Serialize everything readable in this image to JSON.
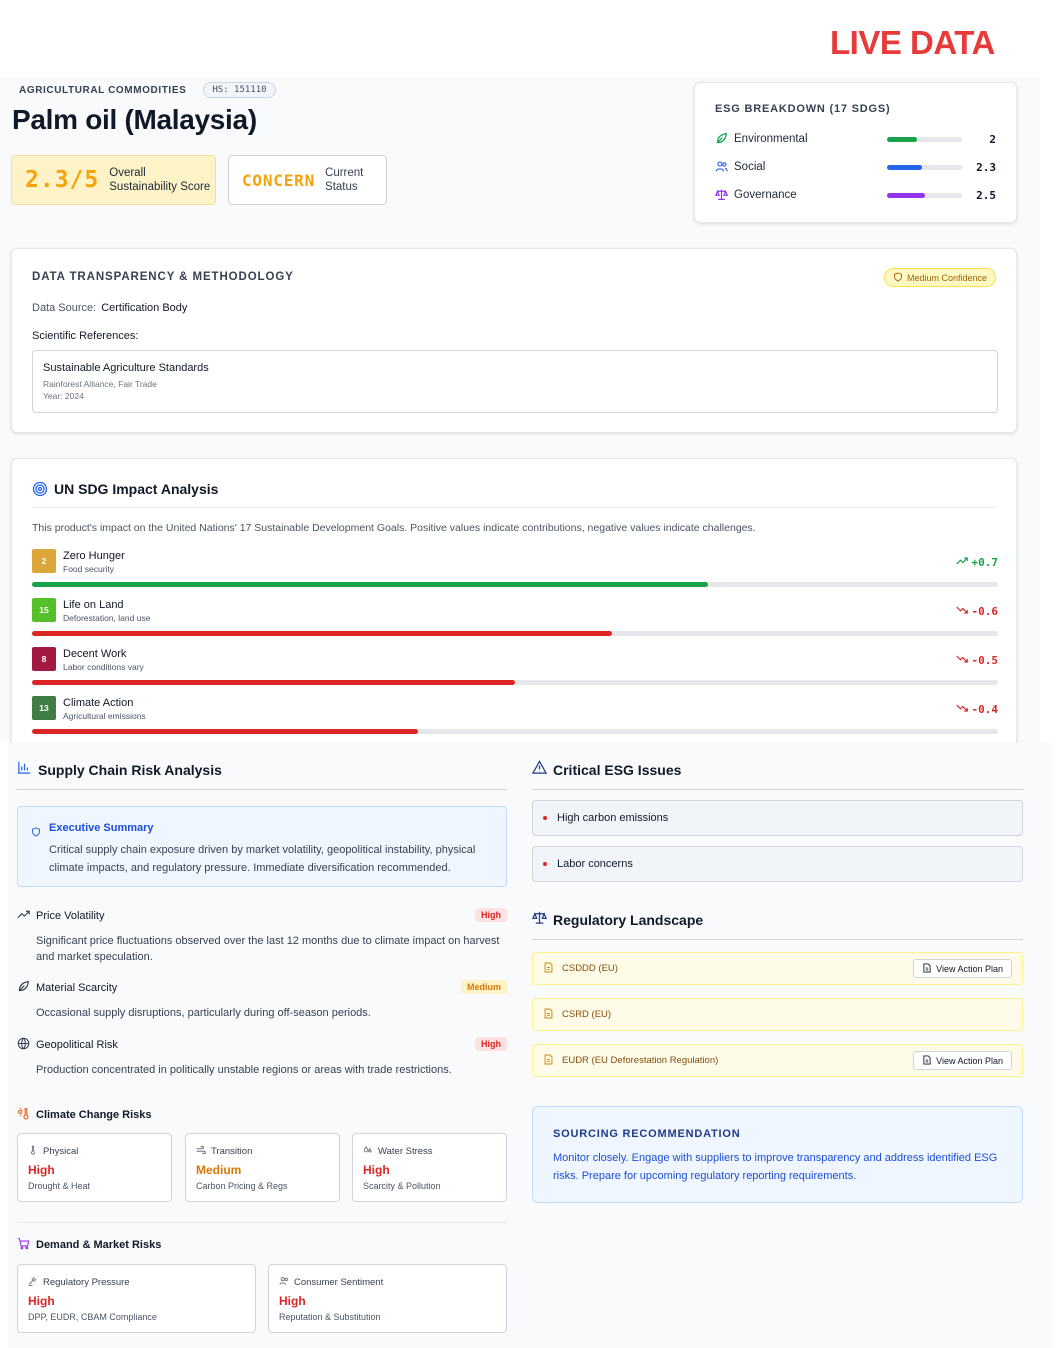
{
  "banner": "LIVE DATA",
  "header": {
    "category": "AGRICULTURAL COMMODITIES",
    "hs_code": "HS: 151110",
    "title": "Palm oil (Malaysia)",
    "score": "2.3/5",
    "score_label_1": "Overall",
    "score_label_2": "Sustainability Score",
    "status": "CONCERN",
    "status_label_1": "Current",
    "status_label_2": "Status"
  },
  "esg": {
    "title": "ESG BREAKDOWN (17 SDGS)",
    "rows": [
      {
        "label": "Environmental",
        "value": "2",
        "fraction": 0.4,
        "color": "#16a34a",
        "icon": "leaf-icon"
      },
      {
        "label": "Social",
        "value": "2.3",
        "fraction": 0.46,
        "color": "#2563eb",
        "icon": "users-icon"
      },
      {
        "label": "Governance",
        "value": "2.5",
        "fraction": 0.5,
        "color": "#9333ea",
        "icon": "scale-icon"
      }
    ]
  },
  "transparency": {
    "title": "DATA TRANSPARENCY & METHODOLOGY",
    "confidence": "Medium Confidence",
    "source_key": "Data Source:",
    "source_value": "Certification Body",
    "refs_label": "Scientific References:",
    "ref_title": "Sustainable Agriculture Standards",
    "ref_authors": "Rainforest Alliance, Fair Trade",
    "ref_year": "Year: 2024"
  },
  "sdg": {
    "title": "UN SDG Impact Analysis",
    "description": "This product's impact on the United Nations' 17 Sustainable Development Goals. Positive values indicate contributions, negative values indicate challenges.",
    "rows": [
      {
        "num": "2",
        "name": "Zero Hunger",
        "sub": "Food security",
        "value": "+0.7",
        "fraction": 0.7,
        "positive": true,
        "badge_color": "#dda63a"
      },
      {
        "num": "15",
        "name": "Life on Land",
        "sub": "Deforestation, land use",
        "value": "-0.6",
        "fraction": 0.6,
        "positive": false,
        "badge_color": "#56c02b"
      },
      {
        "num": "8",
        "name": "Decent Work",
        "sub": "Labor conditions vary",
        "value": "-0.5",
        "fraction": 0.5,
        "positive": false,
        "badge_color": "#a21942"
      },
      {
        "num": "13",
        "name": "Climate Action",
        "sub": "Agricultural emissions",
        "value": "-0.4",
        "fraction": 0.4,
        "positive": false,
        "badge_color": "#3f7e44"
      }
    ]
  },
  "supply": {
    "title": "Supply Chain Risk Analysis",
    "exec_title": "Executive Summary",
    "exec_body": "Critical supply chain exposure driven by market volatility, geopolitical instability, physical climate impacts, and regulatory pressure. Immediate diversification recommended.",
    "risks": [
      {
        "name": "Price Volatility",
        "level": "High",
        "desc": "Significant price fluctuations observed over the last 12 months due to climate impact on harvest and market speculation."
      },
      {
        "name": "Material Scarcity",
        "level": "Medium",
        "desc": "Occasional supply disruptions, particularly during off-season periods."
      },
      {
        "name": "Geopolitical Risk",
        "level": "High",
        "desc": "Production concentrated in politically unstable regions or areas with trade restrictions."
      }
    ],
    "climate_title": "Climate Change Risks",
    "climate": [
      {
        "name": "Physical",
        "level": "High",
        "sub": "Drought & Heat"
      },
      {
        "name": "Transition",
        "level": "Medium",
        "sub": "Carbon Pricing & Regs"
      },
      {
        "name": "Water Stress",
        "level": "High",
        "sub": "Scarcity & Pollution"
      }
    ],
    "demand_title": "Demand & Market Risks",
    "demand": [
      {
        "name": "Regulatory Pressure",
        "level": "High",
        "sub": "DPP, EUDR, CBAM Compliance"
      },
      {
        "name": "Consumer Sentiment",
        "level": "High",
        "sub": "Reputation & Substitution"
      }
    ]
  },
  "issues": {
    "title": "Critical ESG Issues",
    "items": [
      "High carbon emissions",
      "Labor concerns"
    ]
  },
  "regulatory": {
    "title": "Regulatory Landscape",
    "items": [
      {
        "name": "CSDDD (EU)",
        "button": "View Action Plan"
      },
      {
        "name": "CSRD (EU)"
      },
      {
        "name": "EUDR (EU Deforestation Regulation)",
        "button": "View Action Plan"
      }
    ]
  },
  "recommendation": {
    "title": "SOURCING RECOMMENDATION",
    "body": "Monitor closely. Engage with suppliers to improve transparency and address identified ESG risks. Prepare for upcoming regulatory reporting requirements."
  }
}
